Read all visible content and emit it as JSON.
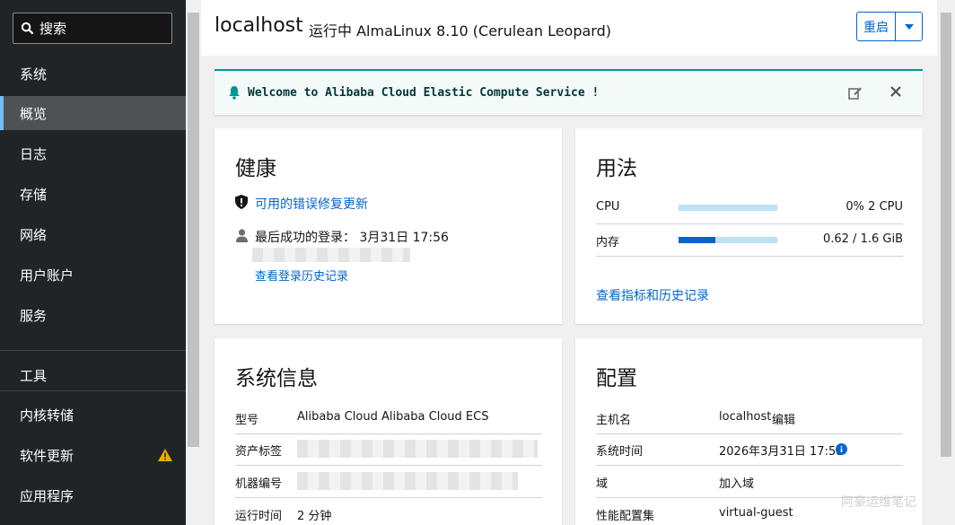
{
  "sidebar": {
    "search_placeholder": "搜索",
    "section_system": "系统",
    "items": [
      "概览",
      "日志",
      "存储",
      "网络",
      "用户账户",
      "服务"
    ],
    "section_tools": "工具",
    "tools": [
      "内核转储",
      "软件更新",
      "应用程序"
    ]
  },
  "header": {
    "hostname": "localhost",
    "status": "运行中 AlmaLinux 8.10 (Cerulean Leopard)",
    "restart_label": "重启"
  },
  "alert": {
    "message": "Welcome to Alibaba Cloud Elastic Compute Service !"
  },
  "health": {
    "title": "健康",
    "updates_link": "可用的错误修复更新",
    "last_login": "最后成功的登录： 3月31日 17:56",
    "history_link": "查看登录历史记录"
  },
  "usage": {
    "title": "用法",
    "cpu_label": "CPU",
    "cpu_value": "0% 2 CPU",
    "cpu_fraction": 0.0,
    "mem_label": "内存",
    "mem_value": "0.62 / 1.6 GiB",
    "mem_fraction": 0.37,
    "metrics_link": "查看指标和历史记录"
  },
  "sysinfo": {
    "title": "系统信息",
    "model_label": "型号",
    "model_value": "Alibaba Cloud Alibaba Cloud ECS",
    "asset_label": "资产标签",
    "serial_label": "机器编号",
    "uptime_label": "运行时间",
    "uptime_value": "2 分钟"
  },
  "config": {
    "title": "配置",
    "hostname_label": "主机名",
    "hostname_value": "localhost",
    "edit_link": "编辑",
    "time_label": "系统时间",
    "time_value": "2026年3月31日 17:58",
    "domain_label": "域",
    "domain_link": "加入域",
    "profile_label": "性能配置集",
    "profile_value": "virtual-guest"
  },
  "watermark": "阿豪运维笔记",
  "colors": {
    "link": "#0066cc",
    "alert_border": "#009596",
    "sidebar_bg": "#212427",
    "warning": "#f0ab00"
  }
}
